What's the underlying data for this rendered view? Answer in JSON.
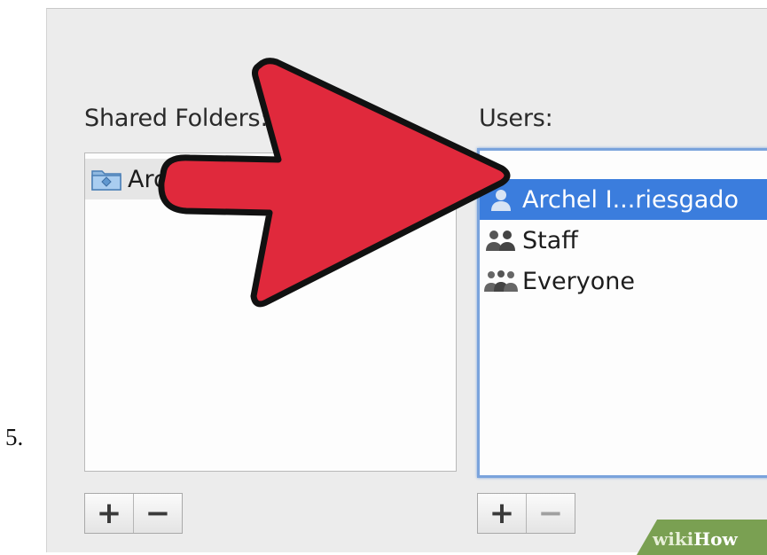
{
  "step_number": "5.",
  "shared_folders": {
    "label": "Shared Folders:",
    "items": [
      {
        "name": "Archel's Public Folder"
      }
    ],
    "add_label": "+",
    "remove_label": "−"
  },
  "users": {
    "label": "Users:",
    "items": [
      {
        "name": "Archel I...riesgado",
        "icon": "user-icon",
        "selected": true
      },
      {
        "name": "Staff",
        "icon": "group-icon",
        "selected": false
      },
      {
        "name": "Everyone",
        "icon": "everyone-icon",
        "selected": false
      }
    ],
    "add_label": "+",
    "remove_label": "−"
  },
  "watermark": {
    "prefix": "wiki",
    "suffix": "How"
  },
  "colors": {
    "selection": "#3b7ddd",
    "arrow_fill": "#e0293c",
    "focus_ring": "#7aa3dc",
    "watermark": "#7aa052"
  }
}
